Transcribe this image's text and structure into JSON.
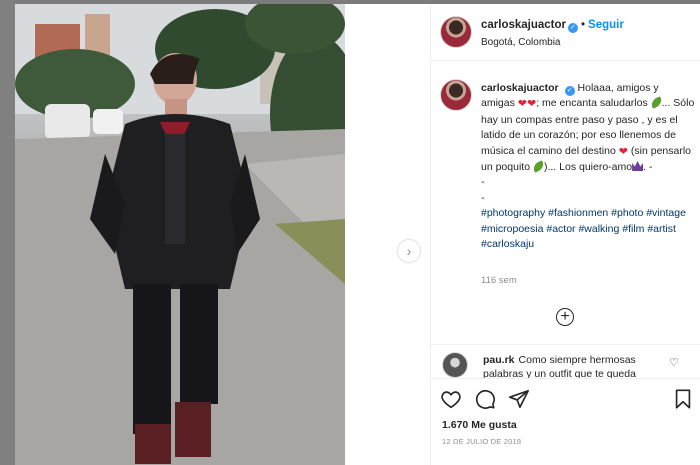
{
  "post": {
    "username": "carloskajuactor",
    "follow_label": "Seguir",
    "location": "Bogotá, Colombia"
  },
  "caption": {
    "username": "carloskajuactor",
    "p1": "Holaaa, amigos y amigas",
    "p2": "; me encanta saludarlos",
    "p3": "... Sólo hay un compas entre paso y paso , y es el latido de un corazón; por eso llenemos de música el camino del destino",
    "p4": "(sin pensarlo un poquito",
    "p5": ")... Los quiero-amo",
    "p6": ". -",
    "dash1": "-",
    "dash2": "-",
    "hashtags": "#photography #fashionmen #photo #vintage #micropoesia #actor #walking #film #artist #carloskaju",
    "age": "116 sem"
  },
  "comment": {
    "username": "pau.rk",
    "text": "Como siempre hermosas palabras y un outfit que te queda"
  },
  "footer": {
    "likes": "1.670 Me gusta",
    "date": "12 DE JULIO DE 2018"
  },
  "icons": {
    "next": "chevron-right-icon",
    "like": "heart-outline-icon",
    "comment": "comment-bubble-icon",
    "share": "paper-plane-icon",
    "save": "bookmark-icon",
    "add": "plus-circle-icon"
  },
  "colors": {
    "link_blue": "#0095f6",
    "hashtag": "#00376b",
    "verified": "#3897f0"
  }
}
